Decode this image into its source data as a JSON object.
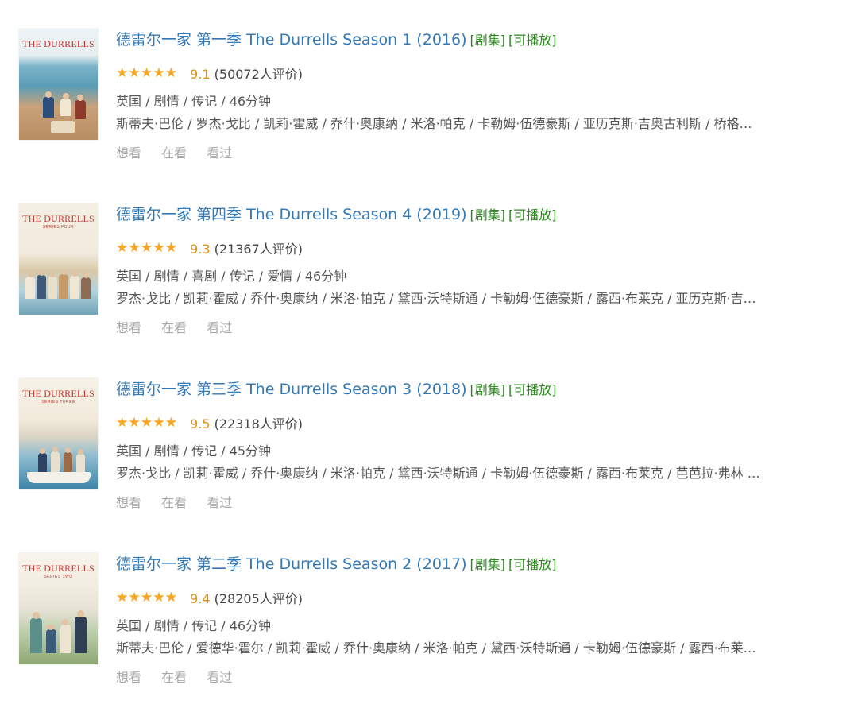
{
  "items": [
    {
      "poster_title": "THE DURRELLS",
      "poster_subtitle": "",
      "title": "德雷尔一家 第一季 The Durrells Season 1 (2016)",
      "tags": [
        "[剧集]",
        "[可播放]"
      ],
      "rating": 4.5,
      "score": "9.1",
      "votes": "(50072人评价)",
      "meta": "英国 / 剧情 / 传记 / 46分钟",
      "cast": "斯蒂夫·巴伦 / 罗杰·戈比 / 凯莉·霍威 / 乔什·奥康纳 / 米洛·帕克 / 卡勒姆·伍德豪斯 / 亚历克斯·吉奥古利斯 / 桥格…",
      "actions": [
        "想看",
        "在看",
        "看过"
      ]
    },
    {
      "poster_title": "THE DURRELLS",
      "poster_subtitle": "SERIES FOUR",
      "title": "德雷尔一家 第四季 The Durrells Season 4 (2019)",
      "tags": [
        "[剧集]",
        "[可播放]"
      ],
      "rating": 4.5,
      "score": "9.3",
      "votes": "(21367人评价)",
      "meta": "英国 / 剧情 / 喜剧 / 传记 / 爱情 / 46分钟",
      "cast": "罗杰·戈比 / 凯莉·霍威 / 乔什·奥康纳 / 米洛·帕克 / 黛西·沃特斯通 / 卡勒姆·伍德豪斯 / 露西·布莱克 / 亚历克斯·吉…",
      "actions": [
        "想看",
        "在看",
        "看过"
      ]
    },
    {
      "poster_title": "THE DURRELLS",
      "poster_subtitle": "SERIES THREE",
      "title": "德雷尔一家 第三季 The Durrells Season 3 (2018)",
      "tags": [
        "[剧集]",
        "[可播放]"
      ],
      "rating": 5,
      "score": "9.5",
      "votes": "(22318人评价)",
      "meta": "英国 / 剧情 / 传记 / 45分钟",
      "cast": "罗杰·戈比 / 凯莉·霍威 / 乔什·奥康纳 / 米洛·帕克 / 黛西·沃特斯通 / 卡勒姆·伍德豪斯 / 露西·布莱克 / 芭芭拉·弗林 …",
      "actions": [
        "想看",
        "在看",
        "看过"
      ]
    },
    {
      "poster_title": "THE DURRELLS",
      "poster_subtitle": "SERIES TWO",
      "title": "德雷尔一家 第二季 The Durrells Season 2 (2017)",
      "tags": [
        "[剧集]",
        "[可播放]"
      ],
      "rating": 4.5,
      "score": "9.4",
      "votes": "(28205人评价)",
      "meta": "英国 / 剧情 / 传记 / 46分钟",
      "cast": "斯蒂夫·巴伦 / 爱德华·霍尔 / 凯莉·霍威 / 乔什·奥康纳 / 米洛·帕克 / 黛西·沃特斯通 / 卡勒姆·伍德豪斯 / 露西·布莱…",
      "actions": [
        "想看",
        "在看",
        "看过"
      ]
    }
  ],
  "colors": {
    "title_link": "#3478b5",
    "tag": "#2b8a1e",
    "star": "#f5a623",
    "score": "#e09015",
    "action": "#a8a8a8"
  }
}
